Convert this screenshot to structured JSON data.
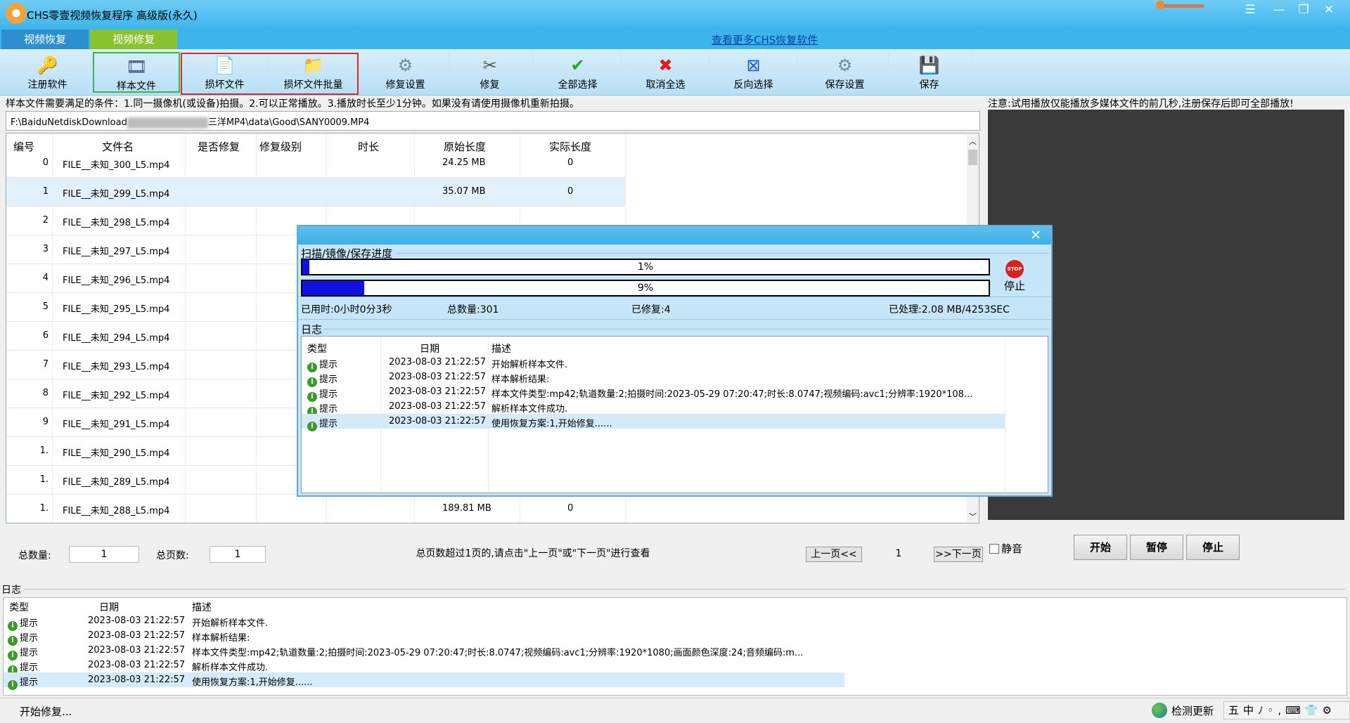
{
  "window": {
    "title": "CHS零壹视频恢复程序 高级版(永久)",
    "controls": [
      "☰",
      "—",
      "❐",
      "✕"
    ]
  },
  "tabs": [
    {
      "label": "视频恢复"
    },
    {
      "label": "视频修复"
    }
  ],
  "more_link": "查看更多CHS恢复软件",
  "toolbar": [
    {
      "label": "注册软件",
      "icon": "key-icon",
      "glyph": "🔑"
    },
    {
      "label": "样本文件",
      "icon": "film-icon",
      "glyph": "🎞"
    },
    {
      "label": "损坏文件",
      "icon": "broken-file-icon",
      "glyph": "📄"
    },
    {
      "label": "损坏文件批量",
      "icon": "batch-file-icon",
      "glyph": "📁"
    },
    {
      "label": "修复设置",
      "icon": "settings-icon",
      "glyph": "⚙"
    },
    {
      "label": "修复",
      "icon": "tools-icon",
      "glyph": "✂"
    },
    {
      "label": "全部选择",
      "icon": "check-icon",
      "glyph": "✔"
    },
    {
      "label": "取消全选",
      "icon": "uncheck-icon",
      "glyph": "✖"
    },
    {
      "label": "反向选择",
      "icon": "invert-icon",
      "glyph": "⊠"
    },
    {
      "label": "保存设置",
      "icon": "save-settings-icon",
      "glyph": "⚙"
    },
    {
      "label": "保存",
      "icon": "save-icon",
      "glyph": "💾"
    }
  ],
  "conditions": "样本文件需要满足的条件：1.同一摄像机(或设备)拍摄。2.可以正常播放。3.播放时长至少1分钟。如果没有请使用摄像机重新拍摄。",
  "path": {
    "start": "F:\\BaiduNetdiskDownload",
    "end": "三洋MP4\\data\\Good\\SANY0009.MP4"
  },
  "grid": {
    "headers": [
      "编号",
      "文件名",
      "是否修复",
      "修复级别",
      "时长",
      "原始长度",
      "实际长度"
    ],
    "rows": [
      {
        "id": "0",
        "name": "FILE__未知_300_L5.mp4",
        "size": "24.25 MB",
        "actual": "0"
      },
      {
        "id": "1",
        "name": "FILE__未知_299_L5.mp4",
        "size": "35.07 MB",
        "actual": "0"
      },
      {
        "id": "2",
        "name": "FILE__未知_298_L5.mp4",
        "size": "",
        "actual": ""
      },
      {
        "id": "3",
        "name": "FILE__未知_297_L5.mp4",
        "size": "",
        "actual": ""
      },
      {
        "id": "4",
        "name": "FILE__未知_296_L5.mp4",
        "size": "",
        "actual": ""
      },
      {
        "id": "5",
        "name": "FILE__未知_295_L5.mp4",
        "size": "",
        "actual": ""
      },
      {
        "id": "6",
        "name": "FILE__未知_294_L5.mp4",
        "size": "",
        "actual": ""
      },
      {
        "id": "7",
        "name": "FILE__未知_293_L5.mp4",
        "size": "",
        "actual": ""
      },
      {
        "id": "8",
        "name": "FILE__未知_292_L5.mp4",
        "size": "",
        "actual": ""
      },
      {
        "id": "9",
        "name": "FILE__未知_291_L5.mp4",
        "size": "",
        "actual": ""
      },
      {
        "id": "1.",
        "name": "FILE__未知_290_L5.mp4",
        "size": "",
        "actual": ""
      },
      {
        "id": "1.",
        "name": "FILE__未知_289_L5.mp4",
        "size": "",
        "actual": ""
      },
      {
        "id": "1.",
        "name": "FILE__未知_288_L5.mp4",
        "size": "189.81 MB",
        "actual": "0"
      }
    ]
  },
  "pager": {
    "total_label": "总数量:",
    "total": "1",
    "pages_label": "总页数:",
    "pages": "1",
    "hint": "总页数超过1页的,请点击\"上一页\"或\"下一页\"进行查看",
    "prev": "上一页<<",
    "page": "1",
    "next": ">>下一页"
  },
  "notice": "注意:试用播放仅能播放多媒体文件的前几秒,注册保存后即可全部播放!",
  "player": {
    "mute": "静音",
    "start": "开始",
    "pause": "暂停",
    "stop": "停止"
  },
  "dialog": {
    "section1": "扫描/镜像/保存进度",
    "progress1": {
      "text": "1%",
      "value": 0.01
    },
    "progress2": {
      "text": "9%",
      "value": 0.09
    },
    "stop_label": "停止",
    "stop_icon_text": "STOP",
    "elapsed": "已用时:0小时0分3秒",
    "total": "总数量:301",
    "repaired": "已修复:4",
    "processed": "已处理:2.08 MB/4253SEC",
    "log_title": "日志",
    "log_headers": [
      "类型",
      "日期",
      "描述"
    ],
    "log": [
      {
        "type": "提示",
        "date": "2023-08-03 21:22:57",
        "desc": "开始解析样本文件."
      },
      {
        "type": "提示",
        "date": "2023-08-03 21:22:57",
        "desc": "样本解析结果:"
      },
      {
        "type": "提示",
        "date": "2023-08-03 21:22:57",
        "desc": "样本文件类型:mp42;轨道数量:2;拍摄时间:2023-05-29 07:20:47;时长:8.0747;视频编码:avc1;分辨率:1920*108..."
      },
      {
        "type": "提示",
        "date": "2023-08-03 21:22:57",
        "desc": "解析样本文件成功."
      },
      {
        "type": "提示",
        "date": "2023-08-03 21:22:57",
        "desc": "使用恢复方案:1,开始修复......"
      }
    ]
  },
  "log": {
    "title": "日志",
    "headers": [
      "类型",
      "日期",
      "描述"
    ],
    "rows": [
      {
        "type": "提示",
        "date": "2023-08-03 21:22:57",
        "desc": "开始解析样本文件."
      },
      {
        "type": "提示",
        "date": "2023-08-03 21:22:57",
        "desc": "样本解析结果:"
      },
      {
        "type": "提示",
        "date": "2023-08-03 21:22:57",
        "desc": "样本文件类型:mp42;轨道数量:2;拍摄时间:2023-05-29 07:20:47;时长:8.0747;视频编码:avc1;分辨率:1920*1080;画面颜色深度:24;音频编码:m..."
      },
      {
        "type": "提示",
        "date": "2023-08-03 21:22:57",
        "desc": "解析样本文件成功."
      },
      {
        "type": "提示",
        "date": "2023-08-03 21:22:57",
        "desc": "使用恢复方案:1,开始修复......"
      }
    ]
  },
  "status": {
    "text": "开始修复...",
    "update": "检测更新",
    "ime": "五中ﾉ◦,⌨👕⚙"
  },
  "colors": {
    "titlebar": "#3cb4ec",
    "tab_active": "#2c8fd0",
    "tab_green": "#89c22e",
    "progress": "#1010e0",
    "highlight_red": "#d62b2b",
    "highlight_green": "#39b54a"
  }
}
